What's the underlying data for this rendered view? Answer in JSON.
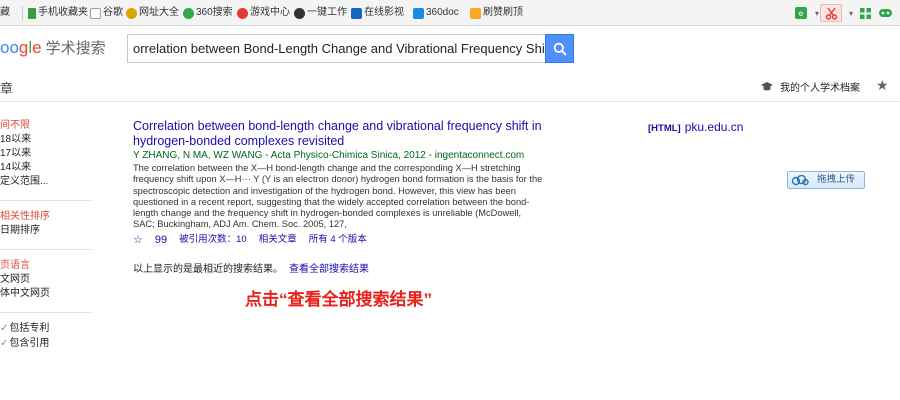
{
  "bookmarks": {
    "items": [
      {
        "label": "藏",
        "icon_color": "#888888"
      },
      {
        "label": "手机收藏夹",
        "icon_color": "#3c9a3c"
      },
      {
        "label": "谷歌",
        "icon_color": "#9e9e9e"
      },
      {
        "label": "网址大全",
        "icon_color": "#d7a400"
      },
      {
        "label": "360搜索",
        "icon_color": "#2ea84a"
      },
      {
        "label": "游戏中心",
        "icon_color": "#e53935"
      },
      {
        "label": "一键工作",
        "icon_color": "#333333"
      },
      {
        "label": "在线影视",
        "icon_color": "#1565c0"
      },
      {
        "label": "360doc",
        "icon_color": "#1e88e5"
      },
      {
        "label": "刷赞刷顶",
        "icon_color": "#f9a825"
      }
    ]
  },
  "header": {
    "logo_letters": [
      "oo",
      "g",
      "l",
      "e"
    ],
    "logo_suffix": "学术搜索",
    "search_value": "orrelation between Bond-Length Change and Vibrational Frequency Shift in Hyd",
    "accent_color": "#4d90fe"
  },
  "subnav": {
    "title": "章",
    "profile_label": "我的个人学术档案"
  },
  "sidebar": {
    "time": {
      "heading": "间不限",
      "items": [
        "18以来",
        "17以来",
        "14以来",
        "定义范围..."
      ]
    },
    "sort": {
      "heading": "相关性排序",
      "items": [
        "日期排序"
      ]
    },
    "lang": {
      "heading": "页语言",
      "items": [
        "文网页",
        "体中文网页"
      ]
    },
    "filters": {
      "items": [
        "包括专利",
        "包含引用"
      ]
    }
  },
  "result": {
    "title": "Correlation between bond-length change and vibrational frequency shift in hydrogen-bonded complexes revisited",
    "meta": "Y ZHANG, N MA, WZ WANG - Acta Physico-Chimica Sinica, 2012 - ingentaconnect.com",
    "snippet": "The correlation between the X—H bond-length change and the corresponding X—H stretching frequency shift upon X—H··· Y (Y is an electron donor) hydrogen bond formation is the basis for the spectroscopic detection and investigation of the hydrogen bond. However, this view has been questioned in a recent report, suggesting that the widely accepted correlation between the bond-length change and the frequency shift in hydrogen-bonded complexes is unreliable (McDowell, SAC; Buckingham, ADJ Am. Chem. Soc. 2005, 127,",
    "links": {
      "save_icon": "☆",
      "cite_icon": "99",
      "cited_by": "被引用次数：10",
      "related": "相关文章",
      "versions": "所有 4 个版本"
    },
    "side_tag": "[HTML]",
    "side_domain": "pku.edu.cn",
    "upload_label": "拖拽上传"
  },
  "footer": {
    "note": "以上显示的是最相近的搜索结果。",
    "link": "查看全部搜索结果"
  },
  "annotation": {
    "text": "点击“查看全部搜索结果”",
    "color": "#e8221a"
  }
}
